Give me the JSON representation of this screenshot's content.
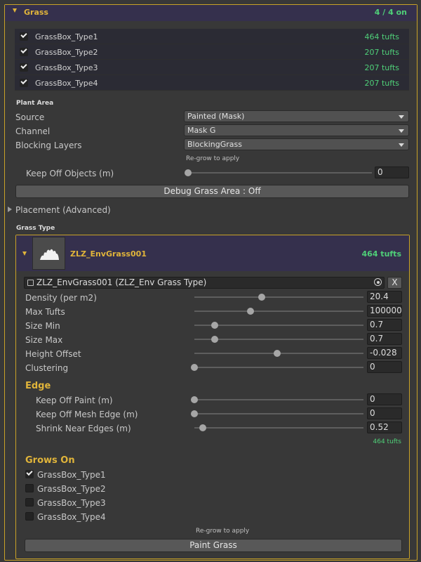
{
  "header": {
    "title": "Grass",
    "count": "4 / 4 on"
  },
  "surface_list": [
    {
      "label": "GrassBox_Type1",
      "checked": true,
      "count": "464 tufts"
    },
    {
      "label": "GrassBox_Type2",
      "checked": true,
      "count": "207 tufts"
    },
    {
      "label": "GrassBox_Type3",
      "checked": true,
      "count": "207 tufts"
    },
    {
      "label": "GrassBox_Type4",
      "checked": true,
      "count": "207 tufts"
    }
  ],
  "plant_area": {
    "heading": "Plant Area",
    "source": {
      "label": "Source",
      "value": "Painted (Mask)"
    },
    "channel": {
      "label": "Channel",
      "value": "Mask G"
    },
    "blocking": {
      "label": "Blocking Layers",
      "value": "BlockingGrass"
    },
    "regrow_hint": "Re-grow to apply",
    "keep_off": {
      "label": "Keep Off Objects (m)",
      "value": "0",
      "level": 0
    },
    "debug_button": "Debug Grass Area : Off"
  },
  "placement": {
    "label": "Placement (Advanced)"
  },
  "grass_type": {
    "heading": "Grass Type",
    "name": "ZLZ_EnvGrass001",
    "count": "464 tufts",
    "object_field": "ZLZ_EnvGrass001 (ZLZ_Env Grass Type)",
    "clear_label": "X",
    "params": [
      {
        "label": "Density (per m2)",
        "value": "20.4",
        "level": 0.4
      },
      {
        "label": "Max Tufts",
        "value": "100000",
        "level": 0.33
      },
      {
        "label": "Size Min",
        "value": "0.7",
        "level": 0.12
      },
      {
        "label": "Size Max",
        "value": "0.7",
        "level": 0.12
      },
      {
        "label": "Height Offset",
        "value": "-0.028",
        "level": 0.49
      },
      {
        "label": "Clustering",
        "value": "0",
        "level": 0
      }
    ],
    "edge": {
      "heading": "Edge",
      "params": [
        {
          "label": "Keep Off Paint (m)",
          "value": "0",
          "level": 0
        },
        {
          "label": "Keep Off Mesh Edge (m)",
          "value": "0",
          "level": 0
        },
        {
          "label": "Shrink Near Edges (m)",
          "value": "0.52",
          "level": 0.05
        }
      ],
      "count": "464 tufts"
    },
    "grows_on": {
      "heading": "Grows On",
      "items": [
        {
          "label": "GrassBox_Type1",
          "checked": true
        },
        {
          "label": "GrassBox_Type2",
          "checked": false
        },
        {
          "label": "GrassBox_Type3",
          "checked": false
        },
        {
          "label": "GrassBox_Type4",
          "checked": false
        }
      ]
    },
    "regrow_hint": "Re-grow to apply",
    "paint_button": "Paint Grass"
  }
}
